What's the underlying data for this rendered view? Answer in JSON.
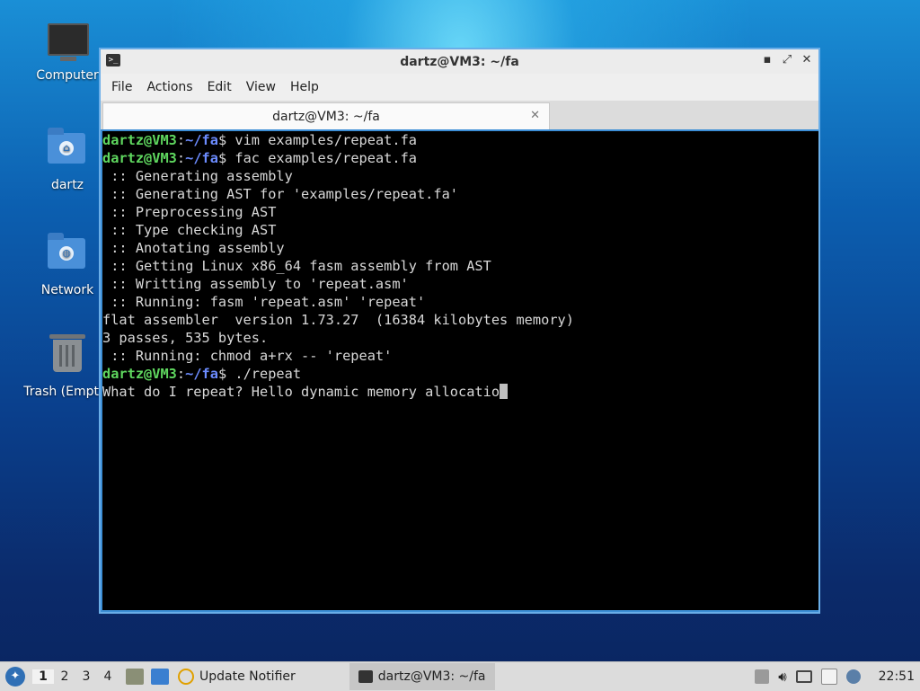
{
  "desktop": {
    "icons": [
      {
        "label": "Computer"
      },
      {
        "label": "dartz"
      },
      {
        "label": "Network"
      },
      {
        "label": "Trash (Empty)"
      }
    ]
  },
  "window": {
    "title": "dartz@VM3: ~/fa",
    "menu": [
      "File",
      "Actions",
      "Edit",
      "View",
      "Help"
    ],
    "tab_title": "dartz@VM3: ~/fa",
    "controls": {
      "minimize": "▪",
      "maximize": "⤢",
      "close": "✕"
    }
  },
  "terminal": {
    "user": "dartz@VM3",
    "path": "~/fa",
    "lines": [
      {
        "type": "cmd",
        "cmd": " vim examples/repeat.fa"
      },
      {
        "type": "cmd",
        "cmd": " fac examples/repeat.fa"
      },
      {
        "type": "out",
        "text": " :: Generating assembly"
      },
      {
        "type": "out",
        "text": " :: Generating AST for 'examples/repeat.fa'"
      },
      {
        "type": "out",
        "text": " :: Preprocessing AST"
      },
      {
        "type": "out",
        "text": " :: Type checking AST"
      },
      {
        "type": "out",
        "text": " :: Anotating assembly"
      },
      {
        "type": "out",
        "text": " :: Getting Linux x86_64 fasm assembly from AST"
      },
      {
        "type": "out",
        "text": " :: Writting assembly to 'repeat.asm'"
      },
      {
        "type": "out",
        "text": " :: Running: fasm 'repeat.asm' 'repeat'"
      },
      {
        "type": "out",
        "text": "flat assembler  version 1.73.27  (16384 kilobytes memory)"
      },
      {
        "type": "out",
        "text": "3 passes, 535 bytes."
      },
      {
        "type": "out",
        "text": " :: Running: chmod a+rx -- 'repeat'"
      },
      {
        "type": "cmd",
        "cmd": " ./repeat"
      },
      {
        "type": "input",
        "text": "What do I repeat? Hello dynamic memory allocatio"
      }
    ]
  },
  "panel": {
    "workspaces": [
      "1",
      "2",
      "3",
      "4"
    ],
    "tasks": [
      "Update Notifier",
      "dartz@VM3: ~/fa"
    ],
    "clock": "22:51"
  }
}
